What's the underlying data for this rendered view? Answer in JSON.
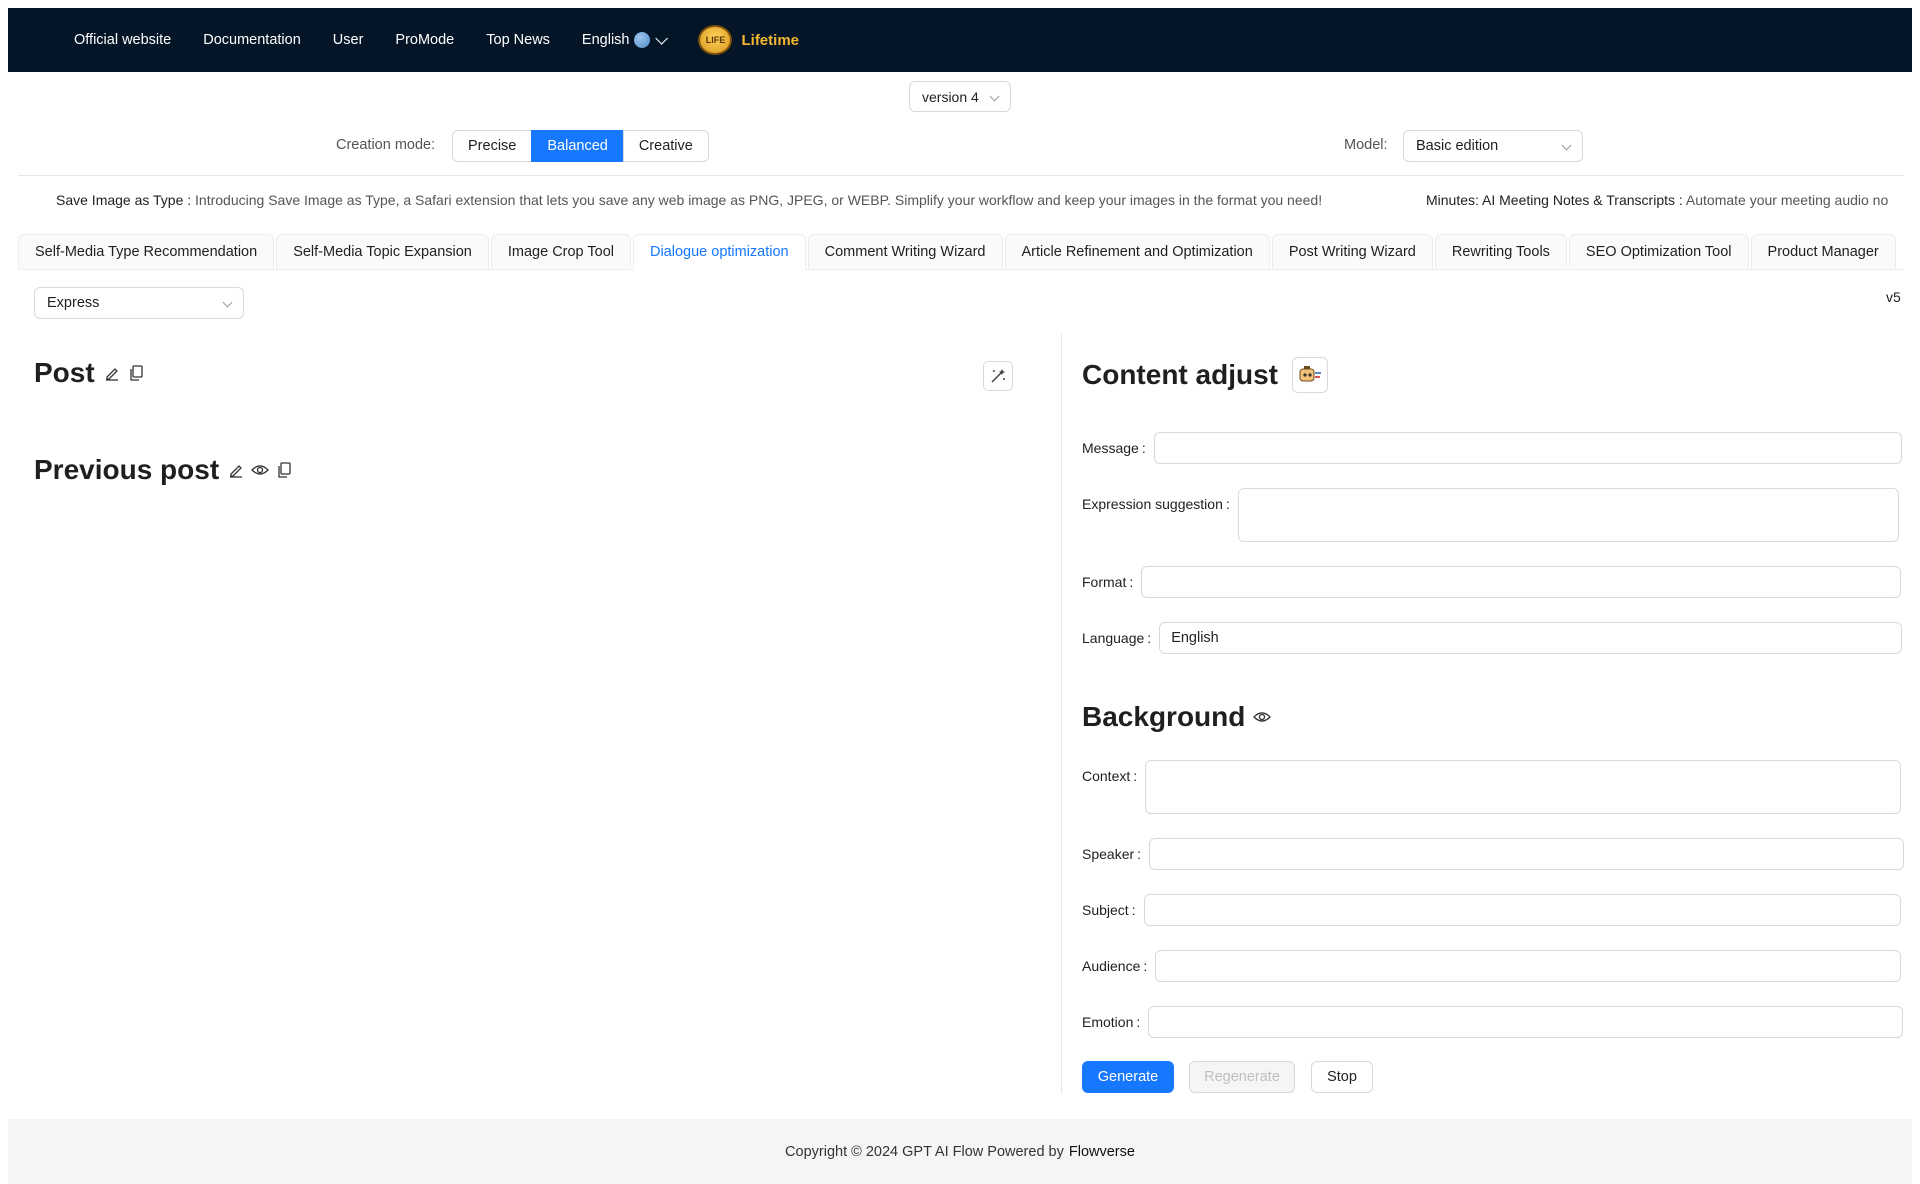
{
  "nav": {
    "items": [
      "Official website",
      "Documentation",
      "User",
      "ProMode",
      "Top News"
    ],
    "language": "English",
    "badge_text": "LIFE",
    "lifetime": "Lifetime"
  },
  "version": {
    "selected": "version 4"
  },
  "creation_mode": {
    "label": "Creation mode:",
    "options": [
      "Precise",
      "Balanced",
      "Creative"
    ],
    "selected": "Balanced"
  },
  "model": {
    "label": "Model:",
    "selected": "Basic edition"
  },
  "ticker": {
    "items": [
      {
        "title": "Save Image as Type",
        "sep": " : ",
        "desc": "Introducing Save Image as Type, a Safari extension that lets you save any web image as PNG, JPEG, or WEBP. Simplify your workflow and keep your images in the format you need!"
      },
      {
        "title": "Minutes: AI Meeting Notes & Transcripts",
        "sep": " : ",
        "desc": "Automate your meeting audio no"
      }
    ]
  },
  "tabs": [
    "Self-Media Type Recommendation",
    "Self-Media Topic Expansion",
    "Image Crop Tool",
    "Dialogue optimization",
    "Comment Writing Wizard",
    "Article Refinement and Optimization",
    "Post Writing Wizard",
    "Rewriting Tools",
    "SEO Optimization Tool",
    "Product Manager"
  ],
  "active_tab": "Dialogue optimization",
  "express": {
    "selected": "Express"
  },
  "version_tag": "v5",
  "left": {
    "post_title": "Post",
    "previous_post_title": "Previous post"
  },
  "content_adjust": {
    "title": "Content adjust",
    "fields": {
      "message": {
        "label": "Message",
        "value": ""
      },
      "expression": {
        "label": "Expression suggestion",
        "value": ""
      },
      "format": {
        "label": "Format",
        "value": ""
      },
      "language": {
        "label": "Language",
        "value": "English"
      }
    }
  },
  "background": {
    "title": "Background",
    "fields": {
      "context": {
        "label": "Context",
        "value": ""
      },
      "speaker": {
        "label": "Speaker",
        "value": ""
      },
      "subject": {
        "label": "Subject",
        "value": ""
      },
      "audience": {
        "label": "Audience",
        "value": ""
      },
      "emotion": {
        "label": "Emotion",
        "value": ""
      }
    }
  },
  "actions": {
    "generate": "Generate",
    "regenerate": "Regenerate",
    "stop": "Stop"
  },
  "footer": {
    "copyright": "Copyright © 2024 GPT AI Flow Powered by",
    "brand": "Flowverse"
  },
  "colors": {
    "nav_bg": "#031527",
    "accent": "#1677ff",
    "lifetime": "#f5b82e",
    "footer_bg": "#f5f5f5"
  }
}
